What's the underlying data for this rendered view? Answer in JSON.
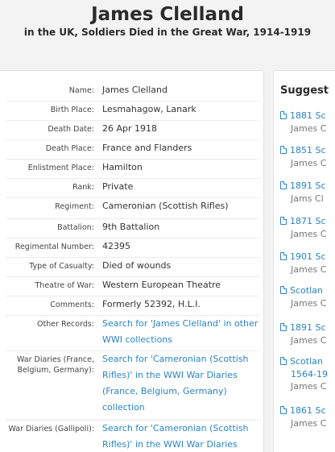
{
  "header": {
    "title": "James Clelland",
    "subtitle": "in the UK, Soldiers Died in the Great War, 1914-1919"
  },
  "details": [
    {
      "label": "Name:",
      "value": "James Clelland",
      "link": false
    },
    {
      "label": "Birth Place:",
      "value": "Lesmahagow, Lanark",
      "link": false
    },
    {
      "label": "Death Date:",
      "value": "26 Apr 1918",
      "link": false
    },
    {
      "label": "Death Place:",
      "value": "France and Flanders",
      "link": false
    },
    {
      "label": "Enlistment Place:",
      "value": "Hamilton",
      "link": false
    },
    {
      "label": "Rank:",
      "value": "Private",
      "link": false
    },
    {
      "label": "Regiment:",
      "value": "Cameronian (Scottish Rifles)",
      "link": false
    },
    {
      "label": "Battalion:",
      "value": "9th Battalion",
      "link": false
    },
    {
      "label": "Regimental Number:",
      "value": "42395",
      "link": false
    },
    {
      "label": "Type of Casualty:",
      "value": "Died of wounds",
      "link": false
    },
    {
      "label": "Theatre of War:",
      "value": "Western European Theatre",
      "link": false
    },
    {
      "label": "Comments:",
      "value": "Formerly 52392, H.L.I.",
      "link": false
    },
    {
      "label": "Other Records:",
      "value": "Search for 'James Clelland' in other WWI collections",
      "link": true
    },
    {
      "label": "War Diaries (France, Belgium, Germany):",
      "value": "Search for 'Cameronian (Scottish Rifles)' in the WWI War Diaries (France, Belgium, Germany) collection",
      "link": true
    },
    {
      "label": "War Diaries (Gallipoli):",
      "value": "Search for 'Cameronian (Scottish Rifles)' in the WWI War Diaries (Gallipoli) collection",
      "link": true
    }
  ],
  "suggestions": {
    "title": "Suggest",
    "items": [
      {
        "title": "1881 Sc",
        "extra": "",
        "sub": "James C"
      },
      {
        "title": "1851 Sc",
        "extra": "",
        "sub": "James C"
      },
      {
        "title": "1891 Sc",
        "extra": "",
        "sub": "Jams Cl"
      },
      {
        "title": "1871 Sc",
        "extra": "",
        "sub": "James C"
      },
      {
        "title": "1901 Sc",
        "extra": "",
        "sub": "James C"
      },
      {
        "title": "Scotlan",
        "extra": "",
        "sub": "James C"
      },
      {
        "title": "1891 Sc",
        "extra": "",
        "sub": "James C"
      },
      {
        "title": "Scotlan",
        "extra": "1564-19",
        "sub": "James C"
      },
      {
        "title": "1861 Sc",
        "extra": "",
        "sub": "James C"
      }
    ]
  },
  "colors": {
    "link": "#2a84c5",
    "background": "#f3f3f3",
    "card": "#ffffff"
  }
}
